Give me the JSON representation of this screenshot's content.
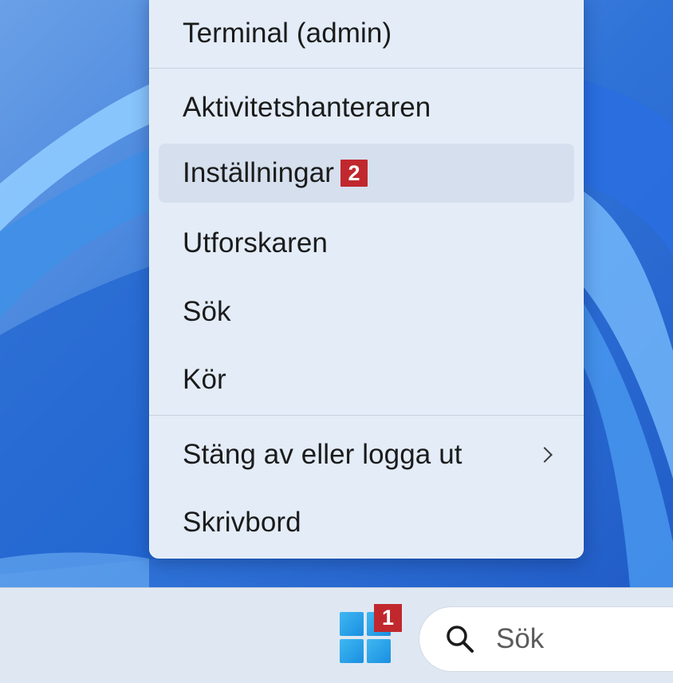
{
  "context_menu": {
    "items": [
      {
        "label": "Terminal (admin)"
      },
      {
        "label": "Aktivitetshanteraren"
      },
      {
        "label": "Inställningar",
        "badge": "2"
      },
      {
        "label": "Utforskaren"
      },
      {
        "label": "Sök"
      },
      {
        "label": "Kör"
      },
      {
        "label": "Stäng av eller logga ut"
      },
      {
        "label": "Skrivbord"
      }
    ]
  },
  "taskbar": {
    "start_badge": "1",
    "search_label": "Sök"
  },
  "colors": {
    "badge": "#c0282d",
    "menu_bg": "#e3ecf7",
    "taskbar_bg": "#dfe8f2",
    "wallpaper": "#2f6fd6"
  },
  "icons": {
    "start": "windows-logo-icon",
    "search": "search-icon",
    "submenu": "chevron-right-icon"
  }
}
